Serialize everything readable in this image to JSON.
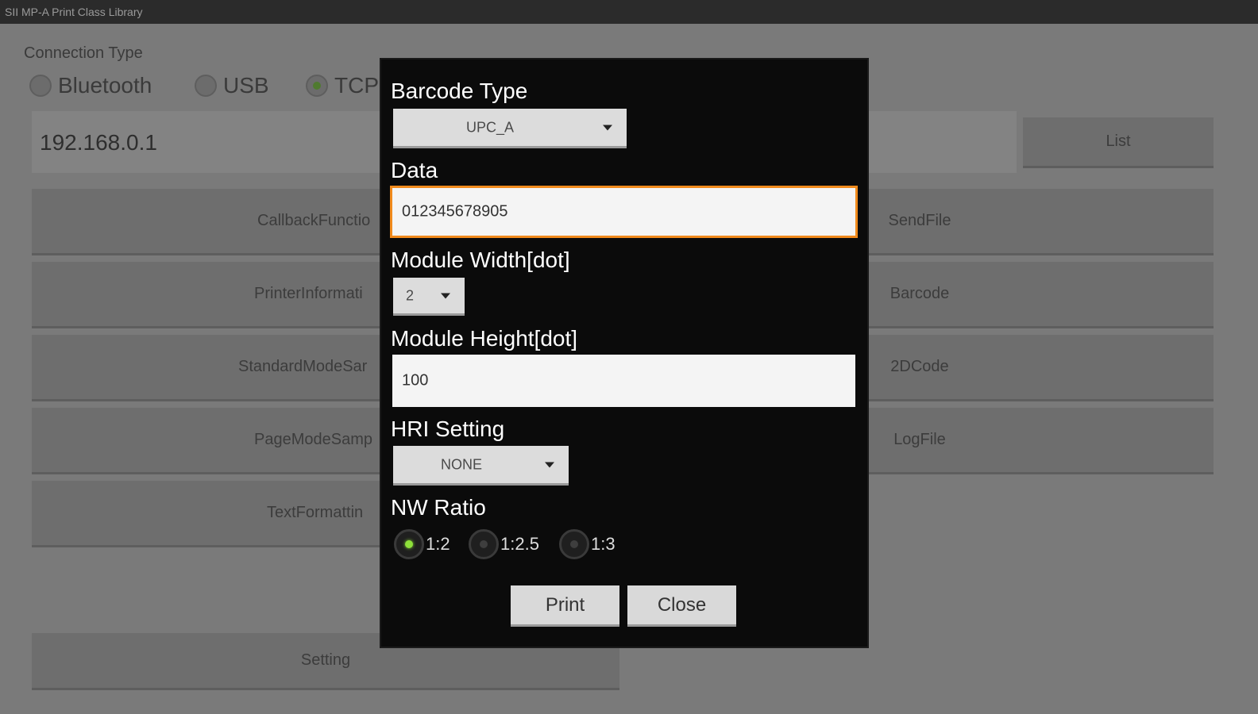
{
  "app": {
    "title": "SII MP-A Print Class Library"
  },
  "connection": {
    "label": "Connection Type",
    "options": [
      {
        "label": "Bluetooth",
        "selected": false
      },
      {
        "label": "USB",
        "selected": false
      },
      {
        "label": "TCP",
        "selected": true
      }
    ],
    "address": "192.168.0.1",
    "list_button": "List"
  },
  "buttons_left": [
    "CallbackFunctio",
    "PrinterInformati",
    "StandardModeSar",
    "PageModeSamp",
    "TextFormattin"
  ],
  "buttons_right": [
    "SendFile",
    "Barcode",
    "2DCode",
    "LogFile"
  ],
  "setting_button": "Setting",
  "dialog": {
    "barcode_type_label": "Barcode Type",
    "barcode_type_value": "UPC_A",
    "data_label": "Data",
    "data_value": "012345678905",
    "module_width_label": "Module Width[dot]",
    "module_width_value": "2",
    "module_height_label": "Module Height[dot]",
    "module_height_value": "100",
    "hri_label": "HRI Setting",
    "hri_value": "NONE",
    "nw_ratio_label": "NW Ratio",
    "nw_ratio_options": [
      {
        "label": "1:2",
        "selected": true
      },
      {
        "label": "1:2.5",
        "selected": false
      },
      {
        "label": "1:3",
        "selected": false
      }
    ],
    "print_button": "Print",
    "close_button": "Close"
  },
  "colors": {
    "focus_border": "#f08a1c",
    "radio_selected": "#8ee13a"
  }
}
